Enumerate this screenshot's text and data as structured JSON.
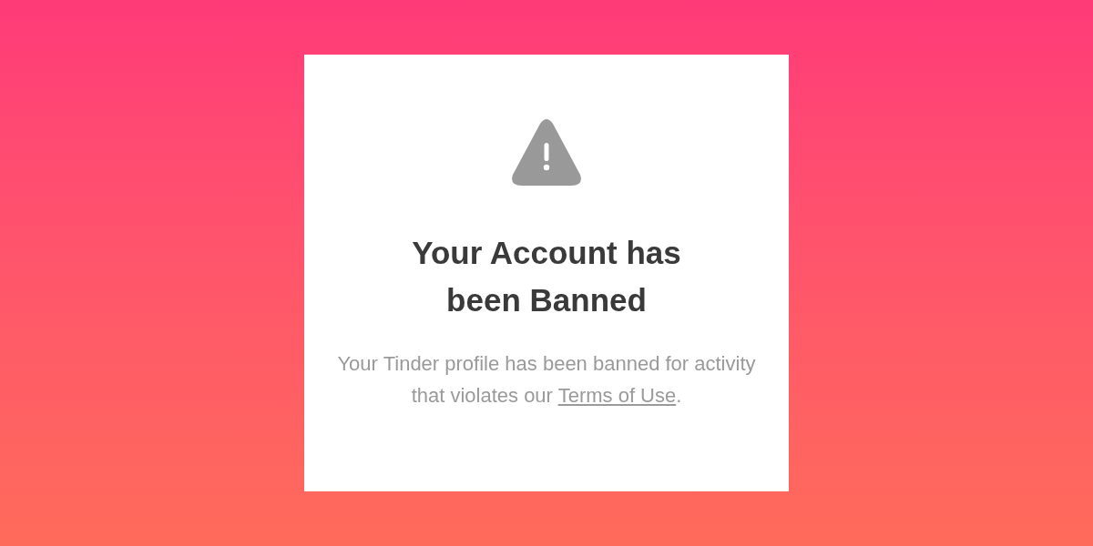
{
  "dialog": {
    "title": "Your Account has been Banned",
    "message": {
      "text": "Your Tinder profile has been banned for activity that violates our",
      "link": "Terms of Use",
      "end": "."
    }
  }
}
